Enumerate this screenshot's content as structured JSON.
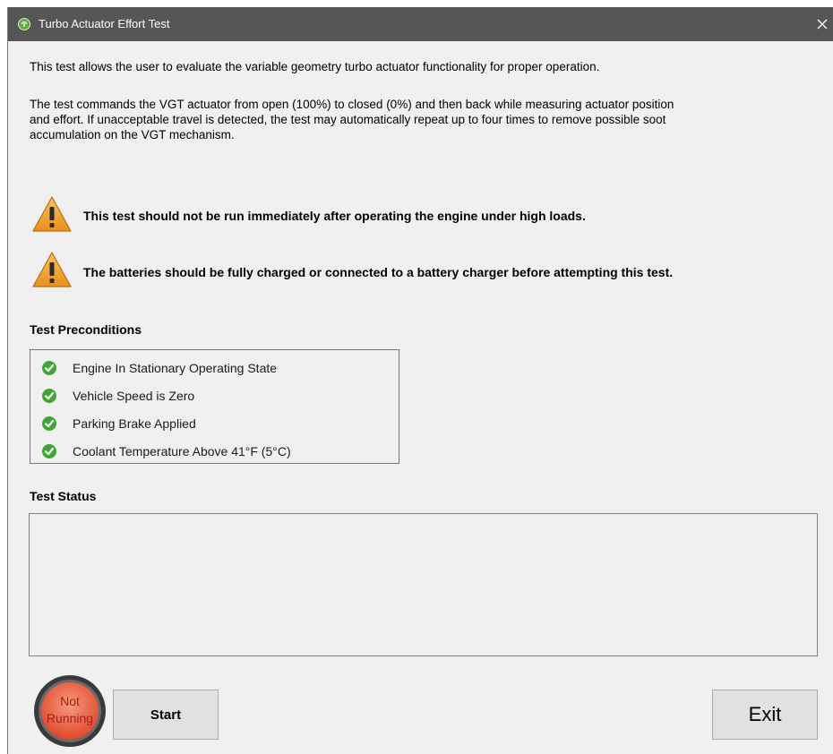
{
  "window": {
    "title": "Turbo Actuator Effort Test"
  },
  "description": {
    "line1": "This test allows the user to evaluate the variable geometry turbo actuator functionality for proper operation.",
    "line2": "The test commands the VGT actuator from open (100%) to closed (0%) and then back while measuring actuator position",
    "line3": "and effort. If unacceptable travel is detected, the test may automatically repeat up to four times to remove possible soot",
    "line4": "accumulation on the VGT mechanism."
  },
  "warnings": [
    {
      "text": "This test should not be run immediately after operating the engine under high loads.",
      "icon": "warning-triangle-icon"
    },
    {
      "text": "The batteries should be fully charged or connected to a battery charger before attempting this test.",
      "icon": "warning-triangle-icon"
    }
  ],
  "preconditions": {
    "label": "Test Preconditions",
    "items": [
      {
        "text": "Engine In Stationary Operating State",
        "status": "met",
        "icon": "check-circle-icon"
      },
      {
        "text": "Vehicle Speed is Zero",
        "status": "met",
        "icon": "check-circle-icon"
      },
      {
        "text": "Parking Brake Applied",
        "status": "met",
        "icon": "check-circle-icon"
      },
      {
        "text": "Coolant Temperature Above 41°F (5°C)",
        "status": "met",
        "icon": "check-circle-icon"
      }
    ]
  },
  "status": {
    "label": "Test Status",
    "text": ""
  },
  "indicator": {
    "line1": "Not",
    "line2": "Running",
    "color": "#e85a3c"
  },
  "buttons": {
    "start": "Start",
    "exit": "Exit"
  },
  "colors": {
    "titlebar": "#565656",
    "warning": "#f0a030",
    "check": "#3fa535",
    "background": "#f0f0f0"
  }
}
